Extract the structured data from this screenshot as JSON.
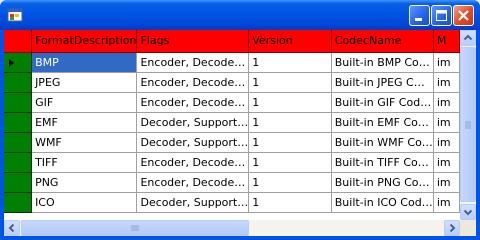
{
  "window": {
    "title": ""
  },
  "grid": {
    "columns": [
      "FormatDescription",
      "Flags",
      "Version",
      "CodecName",
      "M"
    ],
    "rows": [
      [
        "BMP",
        "Encoder, Decode…",
        "1",
        "Built-in BMP Co…",
        "im"
      ],
      [
        "JPEG",
        "Encoder, Decode…",
        "1",
        "Built-in JPEG C…",
        "im"
      ],
      [
        "GIF",
        "Encoder, Decode…",
        "1",
        "Built-in GIF Cod…",
        "im"
      ],
      [
        "EMF",
        "Decoder, Support…",
        "1",
        "Built-in EMF Co…",
        "im"
      ],
      [
        "WMF",
        "Decoder, Support…",
        "1",
        "Built-in WMF Co…",
        "im"
      ],
      [
        "TIFF",
        "Encoder, Decode…",
        "1",
        "Built-in TIFF Co…",
        "im"
      ],
      [
        "PNG",
        "Encoder, Decode…",
        "1",
        "Built-in PNG Co…",
        "im"
      ],
      [
        "ICO",
        "Decoder, Support…",
        "1",
        "Built-in ICO Cod…",
        "im"
      ]
    ],
    "selected_row": 0,
    "header_color": "#ff0000",
    "row_header_color": "#008000",
    "selection_color": "#316ac5"
  },
  "icons": {
    "app": "app-icon",
    "minimize": "minimize-icon",
    "maximize": "maximize-icon",
    "close": "close-icon"
  }
}
